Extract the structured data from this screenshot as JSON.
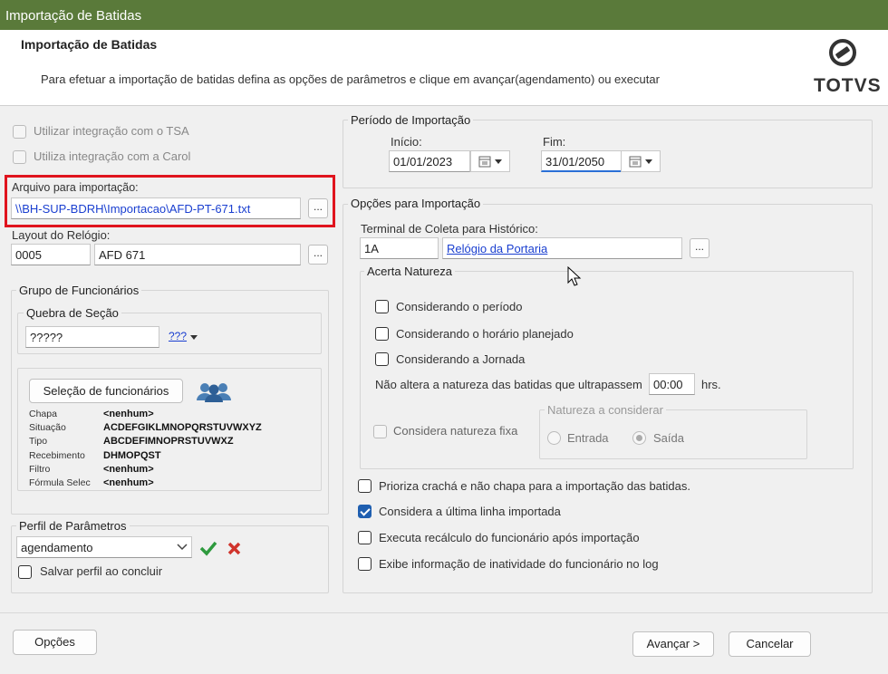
{
  "window": {
    "title": "Importação de Batidas"
  },
  "header": {
    "title": "Importação de Batidas",
    "description": "Para efetuar a importação de batidas defina as opções de parâmetros e clique em avançar(agendamento) ou executar",
    "logo_text": "TOTVS"
  },
  "left": {
    "tsa_label": "Utilizar integração com o TSA",
    "carol_label": "Utiliza integração com a Carol",
    "arquivo_label": "Arquivo para importação:",
    "arquivo_value": "\\\\BH-SUP-BDRH\\Importacao\\AFD-PT-671.txt",
    "browse_label": "...",
    "layout_label": "Layout do Relógio:",
    "layout_code": "0005",
    "layout_name": "AFD 671",
    "grupo_title": "Grupo de Funcionários",
    "quebra_title": "Quebra de Seção",
    "quebra_value": "?????",
    "quebra_selector": "???",
    "selecao_button": "Seleção de funcionários",
    "selection": [
      {
        "key": "Chapa",
        "value": "<nenhum>"
      },
      {
        "key": "Situação",
        "value": "ACDEFGIKLMNOPQRSTUVWXYZ"
      },
      {
        "key": "Tipo",
        "value": "ABCDEFIMNOPRSTUVWXZ"
      },
      {
        "key": "Recebimento",
        "value": "DHMOPQST"
      },
      {
        "key": "Filtro",
        "value": "<nenhum>"
      },
      {
        "key": "Fórmula Selec",
        "value": "<nenhum>"
      }
    ],
    "perfil_title": "Perfil de Parâmetros",
    "perfil_value": "agendamento",
    "salvar_label": "Salvar perfil ao concluir"
  },
  "right": {
    "periodo_title": "Período de Importação",
    "inicio_label": "Início:",
    "inicio_value": "01/01/2023",
    "fim_label": "Fim:",
    "fim_value": "31/01/2050",
    "opcoes_title": "Opções para Importação",
    "terminal_label": "Terminal de Coleta para Histórico:",
    "terminal_code": "1A",
    "terminal_name": "Relógio da Portaria",
    "acerta_title": "Acerta Natureza",
    "considerando_periodo": "Considerando o período",
    "considerando_horario": "Considerando o horário planejado",
    "considerando_jornada": "Considerando a Jornada",
    "nao_altera_label": "Não altera a natureza das batidas que ultrapassem",
    "nao_altera_value": "00:00",
    "hrs_label": "hrs.",
    "natureza_fixa_label": "Considera natureza fixa",
    "natureza_considerar_title": "Natureza a considerar",
    "entrada_label": "Entrada",
    "saida_label": "Saída",
    "prioriza_label": "Prioriza crachá e não chapa para a importação das batidas.",
    "ultima_linha_label": "Considera a última linha importada",
    "recalculo_label": "Executa recálculo do funcionário após importação",
    "inatividade_label": "Exibe informação de inatividade do funcionário no log"
  },
  "footer": {
    "opcoes_button": "Opções",
    "avancar_button": "Avançar >",
    "cancelar_button": "Cancelar"
  },
  "colors": {
    "titlebar": "#5a7a3a",
    "highlight_box": "#e0141e",
    "checkbox_checked": "#1f5fb0",
    "link": "#1a3fd0"
  }
}
